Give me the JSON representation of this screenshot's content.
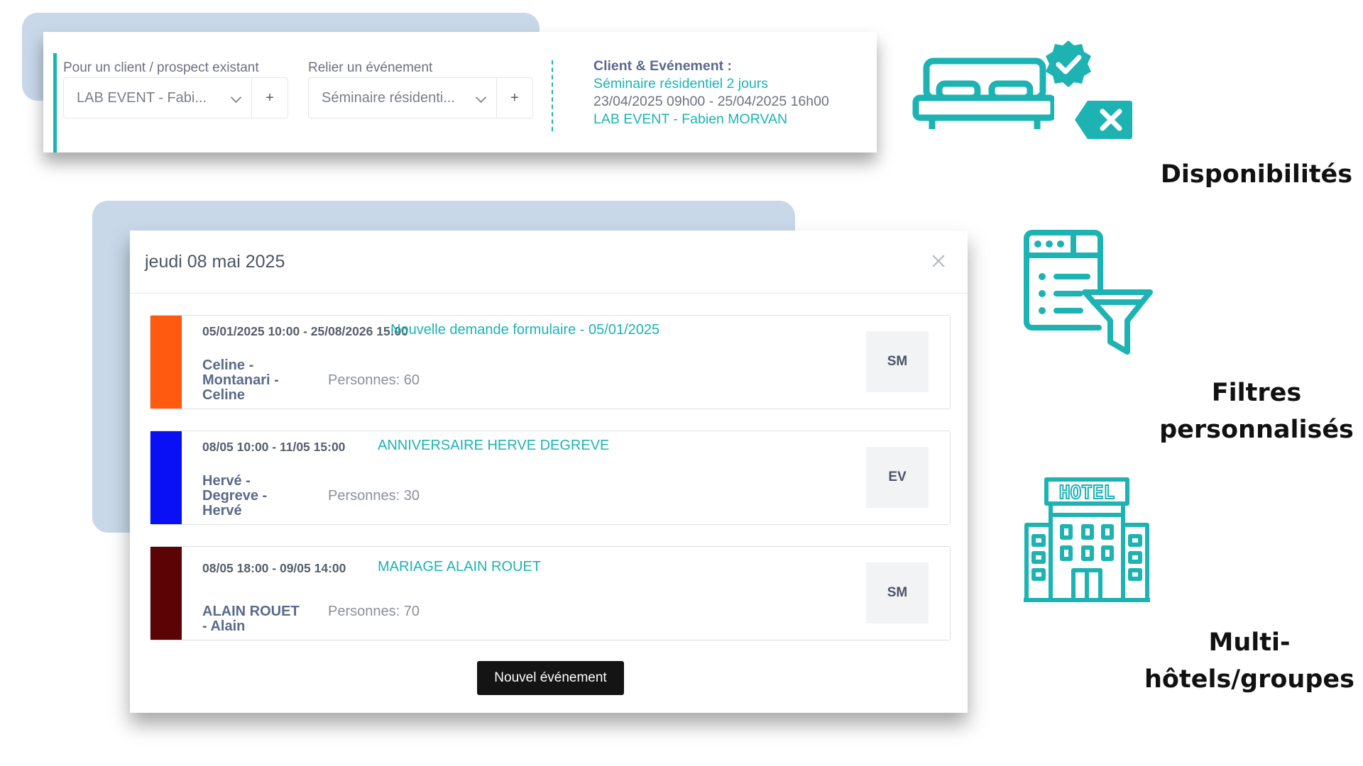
{
  "top_card": {
    "client_label": "Pour un client / prospect existant",
    "client_value": "LAB EVENT - Fabi...",
    "client_add": "+",
    "event_label": "Relier un événement",
    "event_value": "Séminaire résidenti...",
    "event_add": "+",
    "summary_title": "Client & Evénement :",
    "summary_event": "Séminaire résidentiel 2 jours",
    "summary_dates": "23/04/2025 09h00 - 25/04/2025 16h00",
    "summary_client": "LAB EVENT - Fabien MORVAN"
  },
  "modal": {
    "title": "jeudi 08 mai 2025",
    "events": [
      {
        "color": "#ff5a10",
        "dates": "05/01/2025 10:00 - 25/08/2026 15:00",
        "name": "Nouvelle demande formulaire - 05/01/2025",
        "client": "Celine - Montanari - Celine",
        "persons": "Personnes: 60",
        "badge": "SM"
      },
      {
        "color": "#0a10f5",
        "dates": "08/05 10:00 - 11/05 15:00",
        "name": "ANNIVERSAIRE HERVE DEGREVE",
        "client": "Hervé - Degreve - Hervé",
        "persons": "Personnes: 30",
        "badge": "EV"
      },
      {
        "color": "#5a0406",
        "dates": "08/05 18:00 - 09/05 14:00",
        "name": "MARIAGE ALAIN ROUET",
        "client": "ALAIN ROUET - Alain",
        "persons": "Personnes: 70",
        "badge": "SM"
      }
    ],
    "new_event_button": "Nouvel événement"
  },
  "features": {
    "availability": "Disponibilités",
    "filters": "Filtres personnalisés",
    "multi_hotels": "Multi-hôtels/groupes",
    "hotel_sign": "HOTEL"
  },
  "colors": {
    "accent": "#1db3b3",
    "background_block": "#c8d8e8"
  },
  "icons": [
    "bed-icon",
    "check-badge-icon",
    "remove-tag-icon",
    "filter-list-icon",
    "hotel-building-icon",
    "chevron-down-icon",
    "close-icon"
  ]
}
